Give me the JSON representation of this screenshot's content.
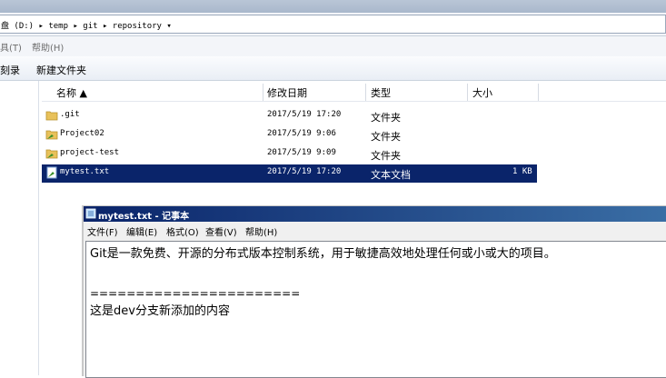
{
  "address": {
    "path": "盘 (D:) ▸ temp ▸ git ▸ repository ▾"
  },
  "menu": {
    "tools": "具(T)",
    "help": "帮助(H)"
  },
  "toolbar": {
    "left_cut": "刻录",
    "new_folder": "新建文件夹"
  },
  "columns": {
    "name": "名称 ▲",
    "modified": "修改日期",
    "type": "类型",
    "size": "大小"
  },
  "files": [
    {
      "name": ".git",
      "date": "2017/5/19 17:20",
      "type": "文件夹",
      "size": "",
      "icon": "folder-icon"
    },
    {
      "name": "Project02",
      "date": "2017/5/19 9:06",
      "type": "文件夹",
      "size": "",
      "icon": "project-folder-icon"
    },
    {
      "name": "project-test",
      "date": "2017/5/19 9:09",
      "type": "文件夹",
      "size": "",
      "icon": "project-folder-icon"
    },
    {
      "name": "mytest.txt",
      "date": "2017/5/19 17:20",
      "type": "文本文档",
      "size": "1 KB",
      "icon": "text-file-icon",
      "selected": true
    }
  ],
  "notepad": {
    "title": "mytest.txt - 记事本",
    "menu": {
      "file": "文件(F)",
      "edit": "编辑(E)",
      "format": "格式(O)",
      "view": "查看(V)",
      "help": "帮助(H)"
    },
    "lines": [
      "Git是一款免费、开源的分布式版本控制系统，用于敏捷高效地处理任何或小或大的项目。",
      "",
      "=======================",
      "这是dev分支新添加的内容"
    ]
  },
  "colors": {
    "selection": "#0a246a",
    "title_gradient_start": "#0a246a",
    "title_gradient_end": "#3a6ea5"
  }
}
